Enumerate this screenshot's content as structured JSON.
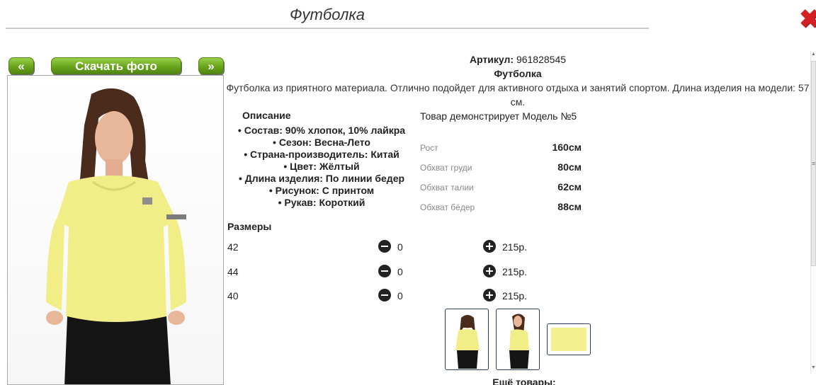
{
  "window": {
    "title": "Футболка",
    "close_icon": "close-x-icon"
  },
  "toolbar": {
    "prev_label": "«",
    "download_label": "Скачать фото",
    "next_label": "»"
  },
  "product": {
    "article_label": "Артикул:",
    "article_value": "961828545",
    "name": "Футболка",
    "description": "Футболка из приятного материала. Отлично подойдет для активного отдыха и занятий спортом. Длина изделия на модели: 57 см."
  },
  "attributes": {
    "title": "Описание",
    "items": [
      "• Состав: 90% хлопок, 10% лайкра",
      "• Сезон: Весна-Лето",
      "• Страна-производитель: Китай",
      "• Цвет: Жёлтый",
      "• Длина изделия: По линии бедер",
      "• Рисунок: С принтом",
      "• Рукав: Короткий"
    ]
  },
  "model": {
    "title": "Товар демонстрирует Модель №5",
    "measurements": [
      {
        "label": "Рост",
        "value": "160см"
      },
      {
        "label": "Обхват груди",
        "value": "80см"
      },
      {
        "label": "Обхват талии",
        "value": "62см"
      },
      {
        "label": "Обхват бёдер",
        "value": "88см"
      }
    ]
  },
  "sizes": {
    "title": "Размеры",
    "rows": [
      {
        "size": "42",
        "qty": "0",
        "price": "215р."
      },
      {
        "size": "44",
        "qty": "0",
        "price": "215р."
      },
      {
        "size": "40",
        "qty": "0",
        "price": "215р."
      }
    ]
  },
  "colors": {
    "accent_green": "#6aa41c",
    "close_red": "#d42020",
    "shirt_yellow": "#f4f08f"
  },
  "more": {
    "label": "Ещё товары:"
  }
}
